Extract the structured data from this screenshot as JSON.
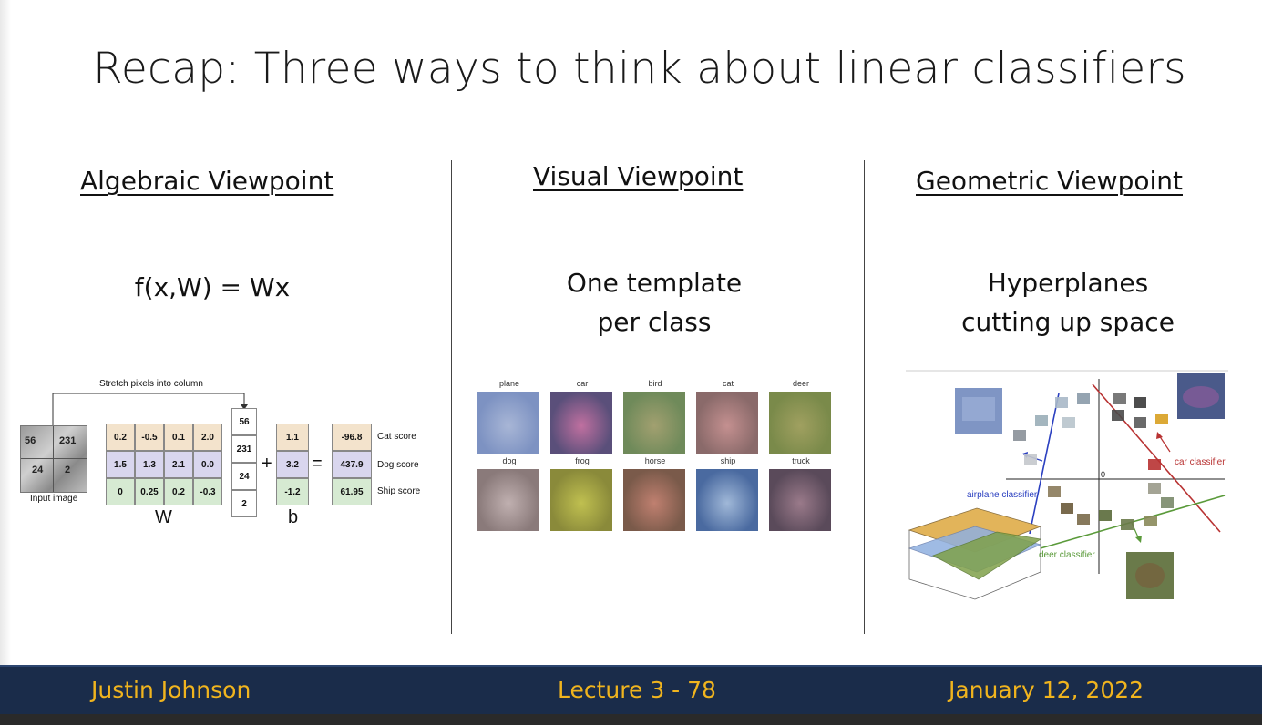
{
  "slide": {
    "title": "Recap: Three ways to think about linear classifiers"
  },
  "columns": {
    "algebraic": {
      "heading": "Algebraic Viewpoint",
      "formula": "f(x,W) = Wx",
      "figure": {
        "stretch_label": "Stretch pixels into column",
        "input_label": "Input image",
        "image_pixels": [
          "56",
          "231",
          "24",
          "2"
        ],
        "W_label": "W",
        "b_label": "b",
        "W": [
          [
            "0.2",
            "-0.5",
            "0.1",
            "2.0"
          ],
          [
            "1.5",
            "1.3",
            "2.1",
            "0.0"
          ],
          [
            "0",
            "0.25",
            "0.2",
            "-0.3"
          ]
        ],
        "x": [
          "56",
          "231",
          "24",
          "2"
        ],
        "b": [
          "1.1",
          "3.2",
          "-1.2"
        ],
        "scores": [
          "-96.8",
          "437.9",
          "61.95"
        ],
        "score_labels": [
          "Cat score",
          "Dog score",
          "Ship score"
        ],
        "plus": "+",
        "equals": "=",
        "row_colors": [
          "#f3e3cc",
          "#d9d6ee",
          "#d6ead2"
        ]
      }
    },
    "visual": {
      "heading": "Visual Viewpoint",
      "line1": "One template",
      "line2": "per class",
      "templates": [
        "plane",
        "car",
        "bird",
        "cat",
        "deer",
        "dog",
        "frog",
        "horse",
        "ship",
        "truck"
      ]
    },
    "geometric": {
      "heading": "Geometric Viewpoint",
      "line1": "Hyperplanes",
      "line2": "cutting up space",
      "figure": {
        "origin_label": "0",
        "car_classifier": "car classifier",
        "airplane_classifier": "airplane classifier",
        "deer_classifier": "deer classifier",
        "colors": {
          "car": "#b83232",
          "airplane": "#2a3fc0",
          "deer": "#5a9a3a"
        }
      }
    }
  },
  "footer": {
    "author": "Justin Johnson",
    "lecture": "Lecture 3 - 78",
    "date": "January 12, 2022"
  }
}
